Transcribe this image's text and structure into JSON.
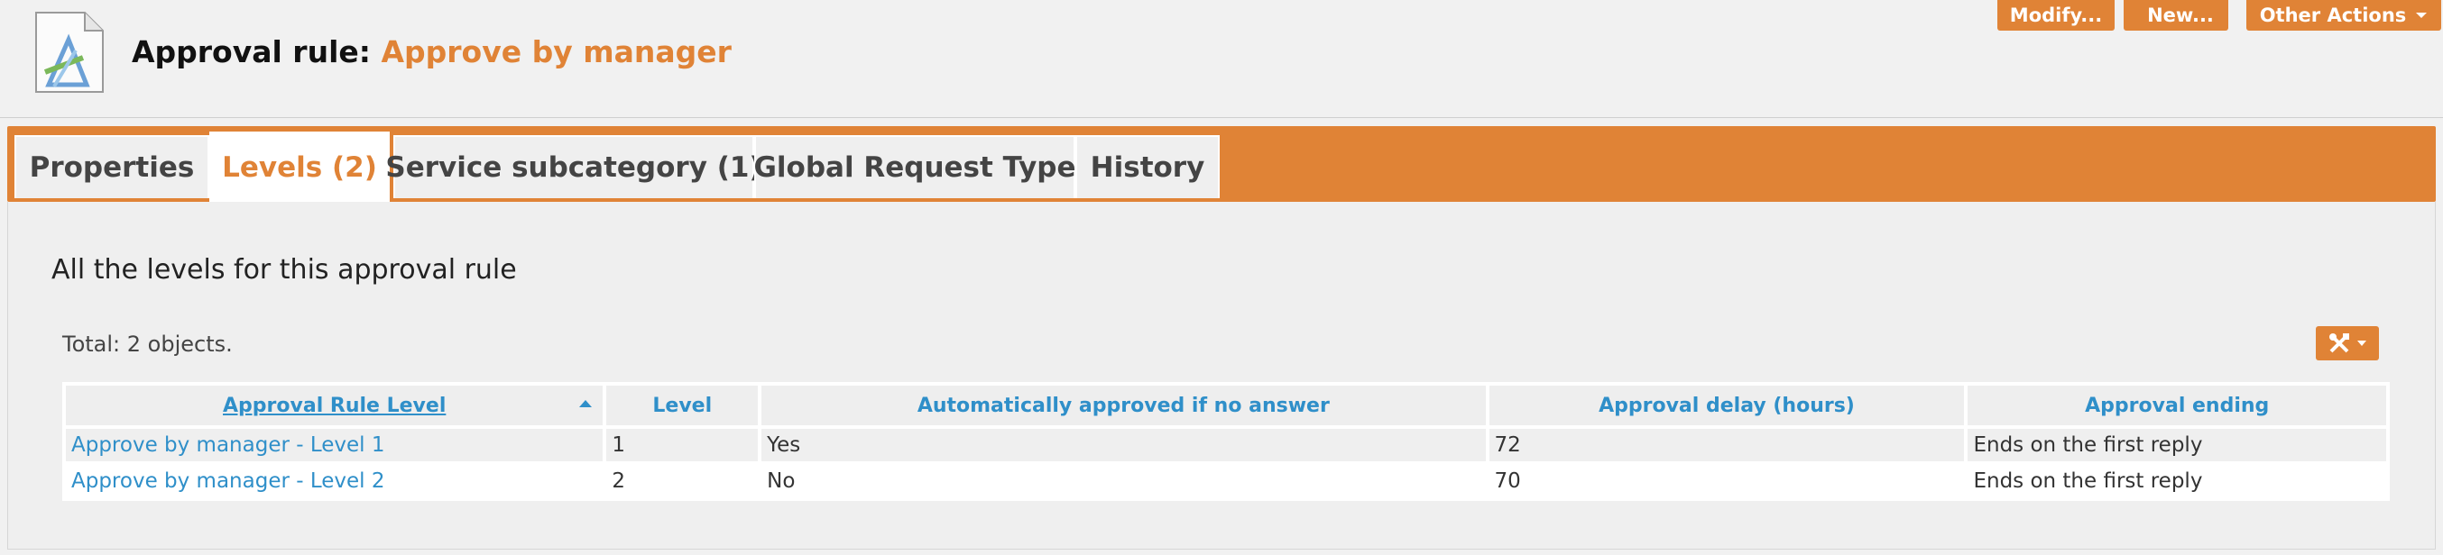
{
  "header": {
    "title_prefix": "Approval rule:",
    "title_name": "Approve by manager",
    "icon": "approval-rule-icon"
  },
  "actions": {
    "refresh_icon": "refresh-icon",
    "search_icon": "search-icon",
    "modify_label": "Modify...",
    "new_label": "New...",
    "other_label": "Other Actions"
  },
  "tabs": [
    {
      "label": "Properties"
    },
    {
      "label": "Levels (2)"
    },
    {
      "label": "Service subcategory (1)"
    },
    {
      "label": "Global Request Type"
    },
    {
      "label": "History"
    }
  ],
  "main": {
    "section_title": "All the levels for this approval rule",
    "total_text": "Total: 2 objects.",
    "tools_icon": "tools-icon"
  },
  "table": {
    "columns": [
      "Approval Rule Level",
      "Level",
      "Automatically approved if no answer",
      "Approval delay (hours)",
      "Approval ending"
    ],
    "rows": [
      [
        "Approve by manager - Level 1",
        "1",
        "Yes",
        "72",
        "Ends on the first reply"
      ],
      [
        "Approve by manager - Level 2",
        "2",
        "No",
        "70",
        "Ends on the first reply"
      ]
    ]
  },
  "colors": {
    "accent": "#e08336",
    "link": "#2f8fc9",
    "background": "#f1f1f1"
  }
}
